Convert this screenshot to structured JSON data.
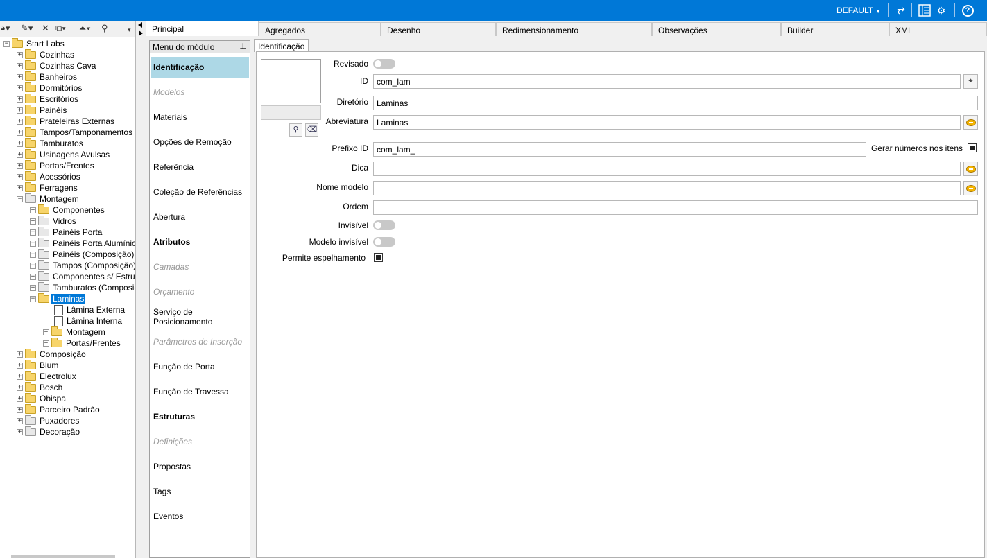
{
  "header": {
    "profile": "DEFAULT",
    "icons": [
      "sync-icon",
      "layout-icon",
      "settings-icon",
      "help-icon"
    ]
  },
  "tree": {
    "root": "Start Labs",
    "items": [
      {
        "label": "Cozinhas"
      },
      {
        "label": "Cozinhas Cava"
      },
      {
        "label": "Banheiros"
      },
      {
        "label": "Dormitórios"
      },
      {
        "label": "Escritórios"
      },
      {
        "label": "Painéis"
      },
      {
        "label": "Prateleiras Externas"
      },
      {
        "label": "Tampos/Tamponamentos"
      },
      {
        "label": "Tamburatos"
      },
      {
        "label": "Usinagens Avulsas"
      },
      {
        "label": "Portas/Frentes"
      },
      {
        "label": "Acessórios"
      },
      {
        "label": "Ferragens"
      },
      {
        "label": "Montagem"
      },
      {
        "label": "Componentes"
      },
      {
        "label": "Vidros"
      },
      {
        "label": "Painéis Porta"
      },
      {
        "label": "Painéis Porta Alumínio"
      },
      {
        "label": "Painéis (Composição)"
      },
      {
        "label": "Tampos (Composição)"
      },
      {
        "label": "Componentes s/ Estrutu"
      },
      {
        "label": "Tamburatos (Composiç"
      },
      {
        "label": "Laminas"
      },
      {
        "label": "Lâmina Externa"
      },
      {
        "label": "Lâmina Interna"
      },
      {
        "label": "Montagem"
      },
      {
        "label": "Portas/Frentes"
      },
      {
        "label": "Composição"
      },
      {
        "label": "Blum"
      },
      {
        "label": "Electrolux"
      },
      {
        "label": "Bosch"
      },
      {
        "label": "Obispa"
      },
      {
        "label": "Parceiro Padrão"
      },
      {
        "label": "Puxadores"
      },
      {
        "label": "Decoração"
      }
    ]
  },
  "tabs": [
    "Principal",
    "Agregados",
    "Desenho",
    "Redimensionamento",
    "Observações",
    "Builder",
    "XML"
  ],
  "module_menu": {
    "title": "Menu do módulo",
    "items": [
      {
        "label": "Identificação"
      },
      {
        "label": "Modelos"
      },
      {
        "label": "Materiais"
      },
      {
        "label": "Opções de Remoção"
      },
      {
        "label": "Referência"
      },
      {
        "label": "Coleção de Referências"
      },
      {
        "label": "Abertura"
      },
      {
        "label": "Atributos"
      },
      {
        "label": "Camadas"
      },
      {
        "label": "Orçamento"
      },
      {
        "label": "Serviço de Posicionamento"
      },
      {
        "label": "Parâmetros de Inserção"
      },
      {
        "label": "Função de Porta"
      },
      {
        "label": "Função de Travessa"
      },
      {
        "label": "Estruturas"
      },
      {
        "label": "Definições"
      },
      {
        "label": "Propostas"
      },
      {
        "label": "Tags"
      },
      {
        "label": "Eventos"
      }
    ]
  },
  "subtab": "Identificação",
  "form": {
    "revisado_label": "Revisado",
    "id_label": "ID",
    "id_value": "com_lam",
    "diretorio_label": "Diretório",
    "diretorio_value": "Laminas",
    "abreviatura_label": "Abreviatura",
    "abreviatura_value": "Laminas",
    "prefixo_label": "Prefixo ID",
    "prefixo_value": "com_lam_",
    "gerar_label": "Gerar números nos itens",
    "dica_label": "Dica",
    "dica_value": "",
    "nome_modelo_label": "Nome modelo",
    "nome_modelo_value": "",
    "ordem_label": "Ordem",
    "ordem_value": "",
    "invisivel_label": "Invisível",
    "modelo_invisivel_label": "Modelo invisível",
    "espelhamento_label": "Permite espelhamento"
  }
}
